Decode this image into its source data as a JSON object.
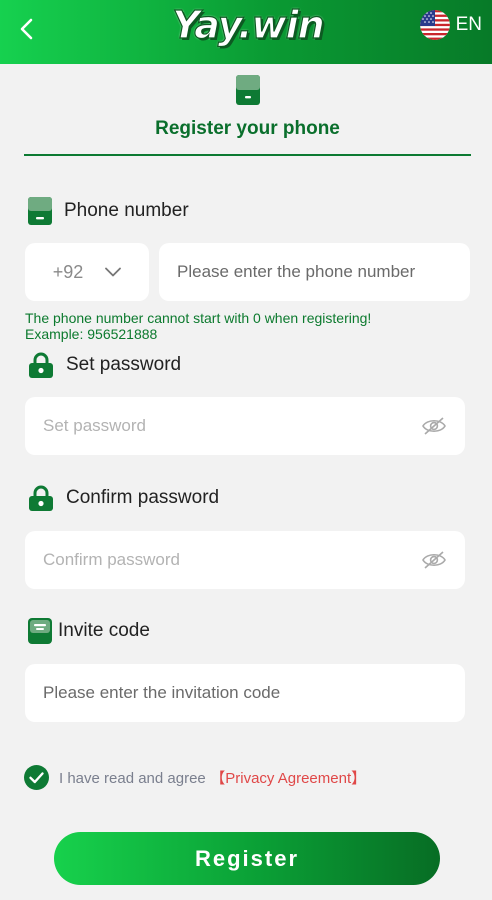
{
  "header": {
    "logo_text": "Yay.win",
    "language": "EN"
  },
  "tab": {
    "title": "Register your phone"
  },
  "phone": {
    "label": "Phone number",
    "country_code": "+92",
    "placeholder": "Please enter the phone number",
    "hint_line1": "The phone number cannot start with 0 when registering!",
    "hint_line2": "Example: 956521888"
  },
  "password": {
    "label": "Set password",
    "placeholder": "Set password"
  },
  "confirm": {
    "label": "Confirm password",
    "placeholder": "Confirm password"
  },
  "invite": {
    "label": "Invite code",
    "placeholder": "Please enter the invitation code"
  },
  "agreement": {
    "text": "I have read and agree",
    "link": "【Privacy Agreement】",
    "checked": true
  },
  "register_label": "Register",
  "colors": {
    "brand_green": "#0a9a33",
    "link_red": "#e04848",
    "hint_green": "#0c7a2e"
  }
}
